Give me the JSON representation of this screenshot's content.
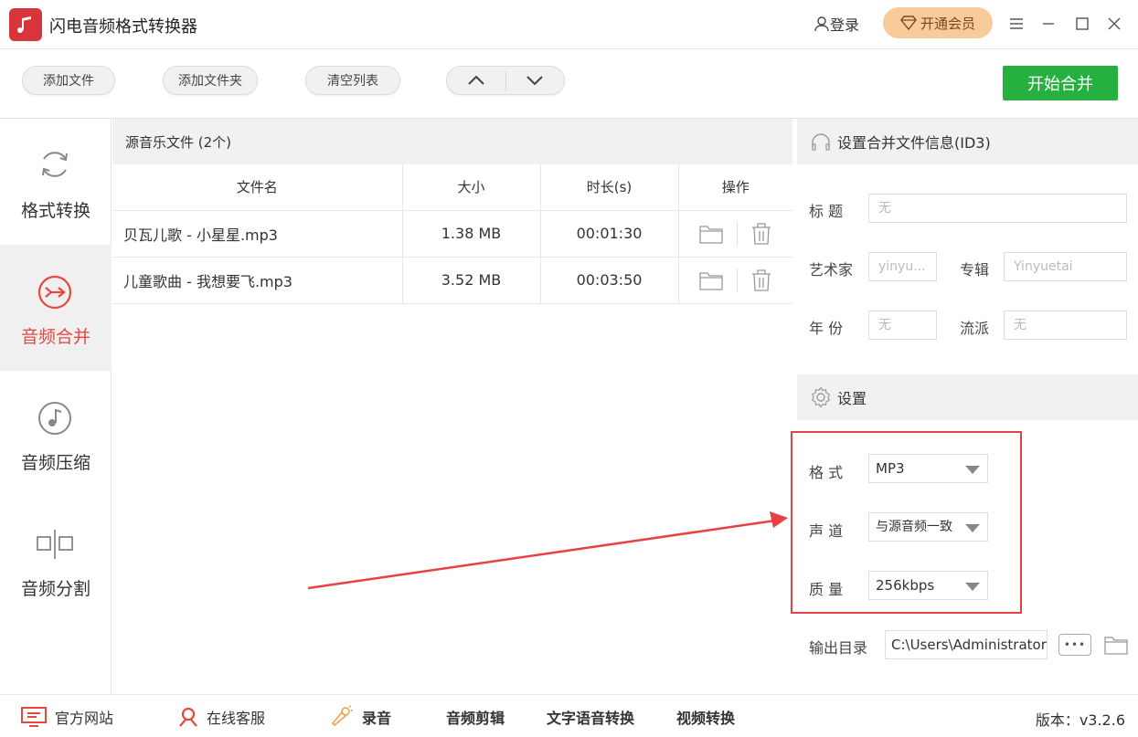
{
  "app": {
    "title": "闪电音频格式转换器"
  },
  "titlebar": {
    "login": "登录",
    "vip": "开通会员"
  },
  "toolbar": {
    "add_file": "添加文件",
    "add_folder": "添加文件夹",
    "clear_list": "清空列表",
    "start_merge": "开始合并"
  },
  "sidebar": {
    "items": [
      {
        "label": "格式转换",
        "icon": "refresh-icon",
        "active": false
      },
      {
        "label": "音频合并",
        "icon": "merge-icon",
        "active": true
      },
      {
        "label": "音频压缩",
        "icon": "music-note-icon",
        "active": false
      },
      {
        "label": "音频分割",
        "icon": "split-icon",
        "active": false
      }
    ]
  },
  "filelist": {
    "header": "源音乐文件 (2个)",
    "columns": [
      "文件名",
      "大小",
      "时长(s)",
      "操作"
    ],
    "rows": [
      {
        "name": "贝瓦儿歌 - 小星星.mp3",
        "size": "1.38 MB",
        "duration": "00:01:30"
      },
      {
        "name": "儿童歌曲 - 我想要飞.mp3",
        "size": "3.52 MB",
        "duration": "00:03:50"
      }
    ]
  },
  "id3": {
    "section_title": "设置合并文件信息(ID3)",
    "title_label": "标  题",
    "title_value": "无",
    "artist_label": "艺术家",
    "artist_value": "yinyu...",
    "album_label": "专辑",
    "album_value": "Yinyuetai",
    "year_label": "年  份",
    "year_value": "无",
    "genre_label": "流派",
    "genre_value": "无"
  },
  "settings": {
    "section_title": "设置",
    "format_label": "格  式",
    "format_value": "MP3",
    "channel_label": "声  道",
    "channel_value": "与源音频一致",
    "quality_label": "质  量",
    "quality_value": "256kbps",
    "output_label": "输出目录",
    "output_value": "C:\\Users\\Administrator",
    "browse_label": "•••"
  },
  "footer": {
    "website": "官方网站",
    "support": "在线客服",
    "record": "录音",
    "audio_edit": "音频剪辑",
    "tts": "文字语音转换",
    "video_convert": "视频转换",
    "version": "版本：v3.2.6"
  },
  "colors": {
    "accent_red": "#e8473c",
    "start_green": "#26b040",
    "vip_gold": "#f8cb9a",
    "annotation_red": "#e84141"
  }
}
